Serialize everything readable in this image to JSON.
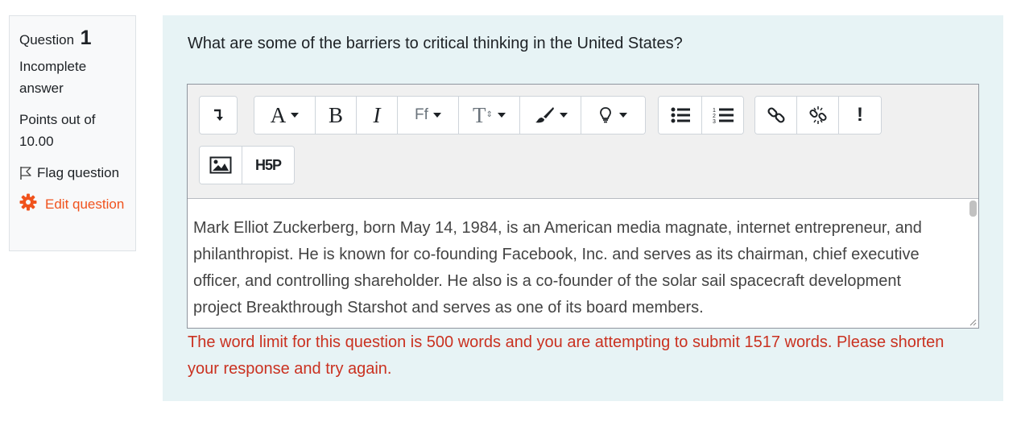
{
  "info": {
    "question_label": "Question",
    "question_number": "1",
    "state": "Incomplete answer",
    "grade": "Points out of 10.00",
    "flag_label": "Flag question",
    "edit_label": "Edit question"
  },
  "question": {
    "text": "What are some of the barriers to critical thinking in the United States?"
  },
  "toolbar": {
    "row1": [
      [
        "show-more-icon"
      ],
      [
        "font-family-menu",
        "bold-icon",
        "italic-icon",
        "font-menu",
        "font-size-menu",
        "font-color-menu",
        "tips-menu"
      ],
      [
        "unordered-list-icon",
        "ordered-list-icon"
      ],
      [
        "link-icon",
        "unlink-icon",
        "accessibility-checker-icon"
      ]
    ],
    "row2": [
      [
        "image-icon",
        "h5p-icon"
      ]
    ],
    "labels": {
      "font_family": "A",
      "bold": "B",
      "italic": "I",
      "font": "Ff",
      "font_size": "T",
      "h5p": "H5P",
      "accessibility": "!"
    }
  },
  "answer": {
    "text": "Mark Elliot Zuckerberg, born May 14, 1984, is an American media magnate, internet entrepreneur, and philanthropist. He is known for co-founding Facebook, Inc. and serves as its chairman, chief executive officer, and controlling shareholder. He also is a co-founder of the solar sail spacecraft development project Breakthrough Starshot and serves as one of its board members."
  },
  "error": {
    "text": "The word limit for this question is 500 words and you are attempting to submit 1517 words. Please shorten your response and try again."
  },
  "colors": {
    "accent": "#f0531d",
    "error": "#ca3120",
    "formulation_bg": "#e7f3f5"
  }
}
